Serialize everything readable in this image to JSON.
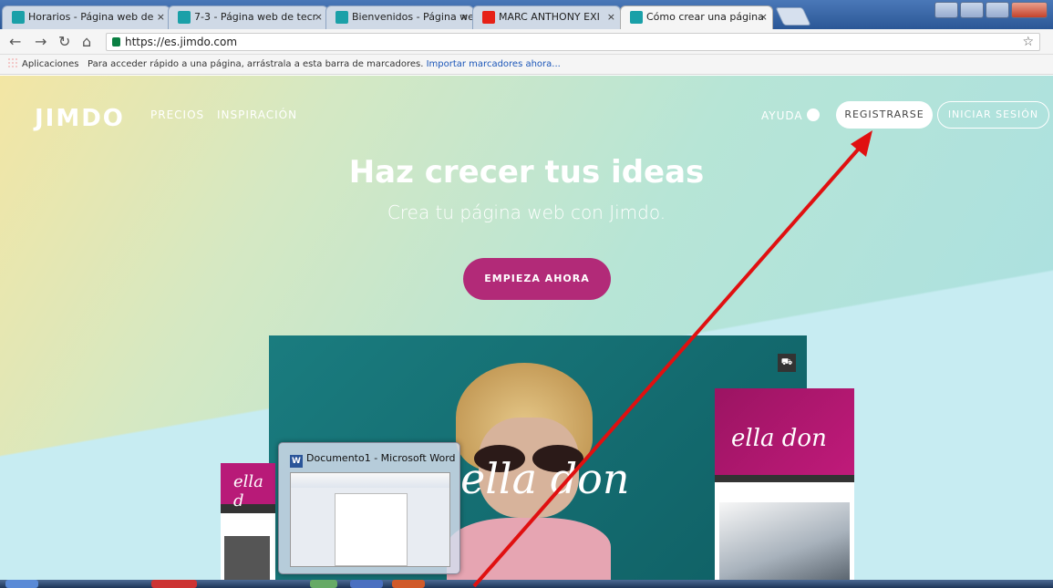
{
  "browser": {
    "tabs": [
      {
        "title": "Horarios - Página web de",
        "favicon": "jimdo-favicon",
        "active": false
      },
      {
        "title": "7-3 - Página web de tecr",
        "favicon": "jimdo-favicon",
        "active": false
      },
      {
        "title": "Bienvenidos - Página wel",
        "favicon": "jimdo-favicon",
        "active": false
      },
      {
        "title": "MARC ANTHONY EXI",
        "favicon": "youtube-favicon",
        "active": false
      },
      {
        "title": "Cómo crear una página",
        "favicon": "jimdo-favicon",
        "active": true
      }
    ],
    "close_glyph": "×",
    "url": "https://es.jimdo.com",
    "bookmarks": {
      "apps_label": "Aplicaciones",
      "hint": "Para acceder rápido a una página, arrástrala a esta barra de marcadores.",
      "import_link": "Importar marcadores ahora..."
    }
  },
  "site": {
    "logo": "JIMDO",
    "nav": {
      "precios": "PRECIOS",
      "inspiracion": "INSPIRACIÓN",
      "ayuda": "AYUDA"
    },
    "register": "REGISTRARSE",
    "login": "INICIAR SESIÓN",
    "headline": "Haz crecer tus ideas",
    "subheadline": "Crea tu página web con Jimdo.",
    "cta": "EMPIEZA AHORA",
    "mockup_brand": "ella don",
    "mockup_brand_left": "ella d"
  },
  "taskbar_preview": {
    "title": "Documento1 - Microsoft Word",
    "icon": "W"
  },
  "colors": {
    "cta": "#b22a78",
    "annotation_arrow": "#e01010"
  }
}
